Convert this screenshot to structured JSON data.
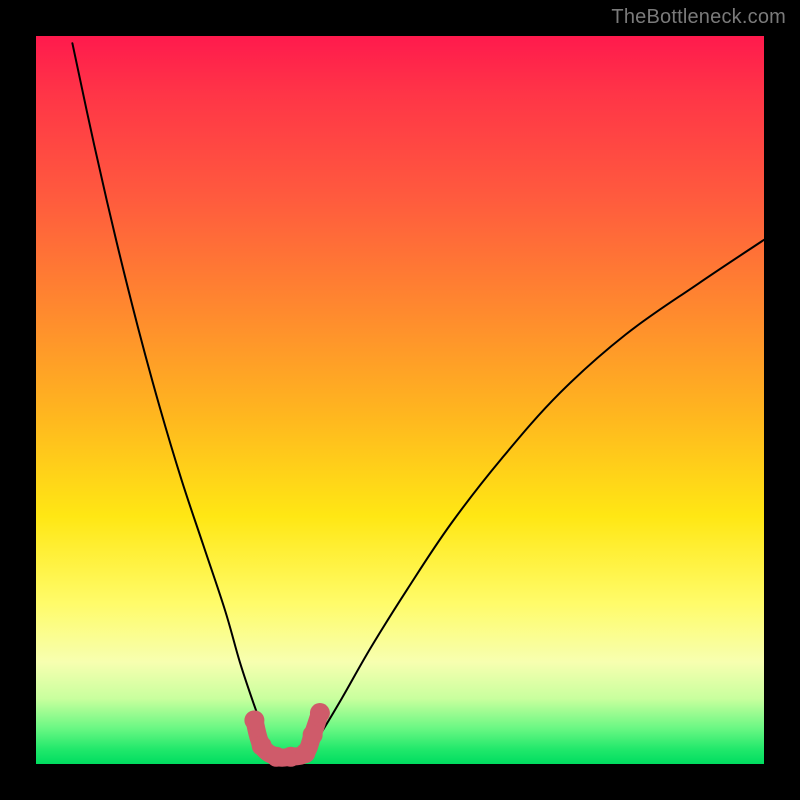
{
  "watermark": "TheBottleneck.com",
  "colors": {
    "marker": "#cf5b6a",
    "curve": "#000000",
    "frame": "#000000"
  },
  "chart_data": {
    "type": "line",
    "title": "",
    "xlabel": "",
    "ylabel": "",
    "xlim": [
      0,
      100
    ],
    "ylim": [
      0,
      100
    ],
    "grid": false,
    "note": "Axes are unlabeled in the source image; x/y values are estimated relative coordinates (0–100) read from pixel positions.",
    "series": [
      {
        "name": "left-curve",
        "x": [
          5,
          8,
          11,
          14,
          17,
          20,
          23,
          26,
          28,
          30,
          31.5,
          33
        ],
        "y": [
          99,
          85,
          72,
          60,
          49,
          39,
          30,
          21,
          14,
          8,
          4,
          1
        ]
      },
      {
        "name": "right-curve",
        "x": [
          37,
          39,
          42,
          46,
          51,
          57,
          64,
          72,
          81,
          91,
          100
        ],
        "y": [
          1,
          4,
          9,
          16,
          24,
          33,
          42,
          51,
          59,
          66,
          72
        ]
      }
    ],
    "highlight": {
      "name": "optimal-range",
      "description": "U-shaped marker at the curve minimum",
      "x": [
        30,
        31,
        33,
        35,
        37,
        38,
        39
      ],
      "y": [
        6,
        2.5,
        1,
        1,
        1.5,
        4,
        7
      ]
    }
  }
}
